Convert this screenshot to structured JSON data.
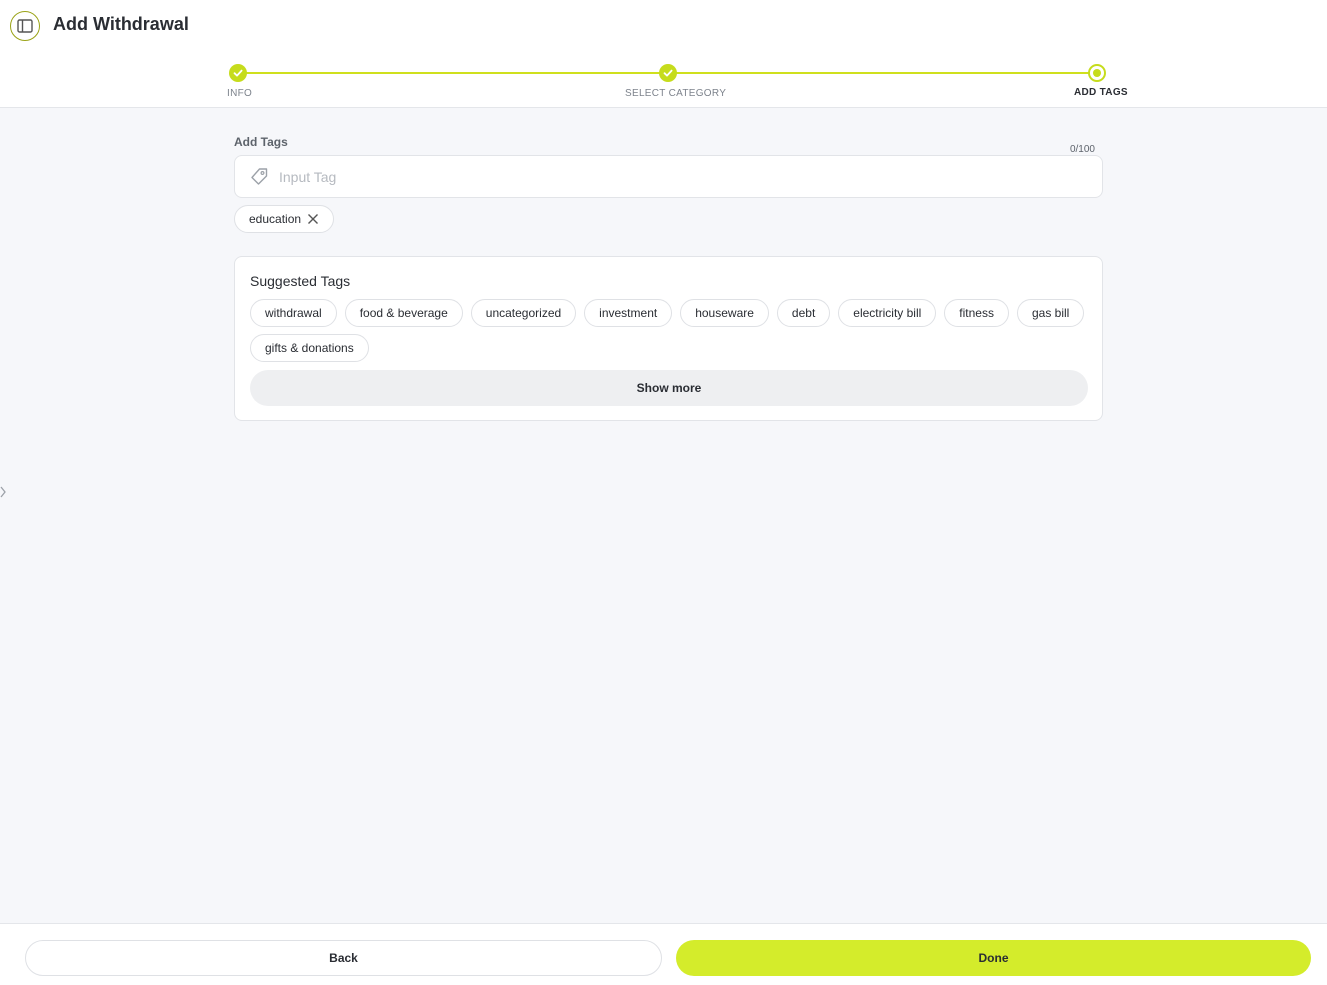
{
  "header": {
    "title": "Add Withdrawal",
    "toggle_icon": "sidebar-panel-icon"
  },
  "stepper": {
    "steps": [
      {
        "label": "INFO",
        "status": "done"
      },
      {
        "label": "SELECT CATEGORY",
        "status": "done"
      },
      {
        "label": "ADD TAGS",
        "status": "current"
      }
    ]
  },
  "tags": {
    "label": "Add Tags",
    "counter": "0/100",
    "placeholder": "Input Tag",
    "value": "",
    "selected": [
      "education"
    ]
  },
  "suggested": {
    "title": "Suggested Tags",
    "items": [
      "withdrawal",
      "food & beverage",
      "uncategorized",
      "investment",
      "houseware",
      "debt",
      "electricity bill",
      "fitness",
      "gas bill",
      "gifts & donations"
    ],
    "show_more_label": "Show more"
  },
  "footer": {
    "back_label": "Back",
    "done_label": "Done"
  },
  "colors": {
    "accent": "#d4ec2b",
    "accent_line": "#cfe01d",
    "background": "#f6f7fa"
  }
}
